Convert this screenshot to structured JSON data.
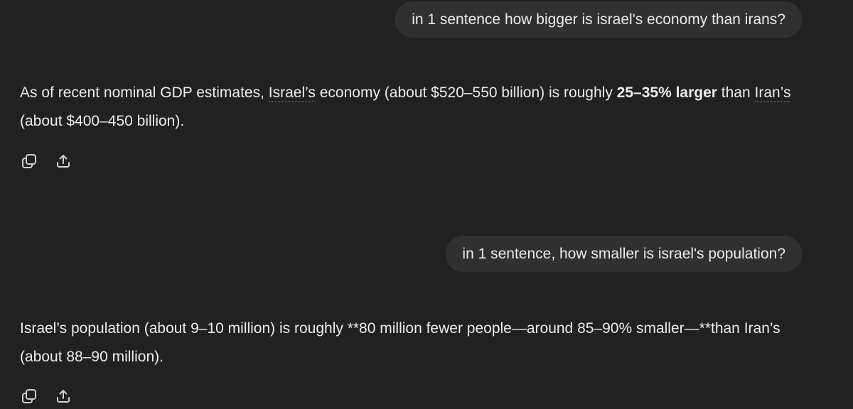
{
  "messages": [
    {
      "role": "user",
      "text": "in 1 sentence how bigger is israel's economy than irans?"
    },
    {
      "role": "assistant",
      "segments": {
        "s1": "As of recent nominal GDP estimates, ",
        "s2": "Israel’s",
        "s3": " economy (about $520–550 billion) is roughly ",
        "s4": "25–35% larger",
        "s5": " than ",
        "s6": "Iran’s",
        "s7": " (about $400–450 billion)."
      },
      "actions": [
        "copy-icon",
        "share-icon"
      ]
    },
    {
      "role": "user",
      "text": "in 1 sentence, how smaller is israel's population?"
    },
    {
      "role": "assistant",
      "text": "Israel’s population (about 9–10 million) is roughly **80 million fewer people—around 85–90% smaller—**than Iran’s (about 88–90 million).",
      "actions": [
        "copy-icon",
        "share-icon"
      ]
    }
  ]
}
